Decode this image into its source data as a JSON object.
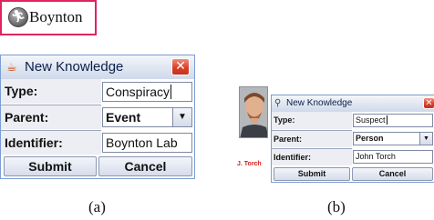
{
  "figure_a": {
    "node": {
      "label": "Boynton",
      "icon": "running-person-icon",
      "border_color": "#e0245e"
    },
    "dialog": {
      "title": "New Knowledge",
      "fields": [
        {
          "label": "Type:",
          "value": "Conspiracy"
        },
        {
          "label": "Parent:",
          "value": "Event"
        },
        {
          "label": "Identifier:",
          "value": "Boynton Lab"
        }
      ],
      "buttons": {
        "submit": "Submit",
        "cancel": "Cancel"
      }
    },
    "caption": "(a)"
  },
  "figure_b": {
    "person_name": "J. Torch",
    "dialog": {
      "title": "New Knowledge",
      "fields": [
        {
          "label": "Type:",
          "value": "Suspect"
        },
        {
          "label": "Parent:",
          "value": "Person"
        },
        {
          "label": "Identifier:",
          "value": "John Torch"
        }
      ],
      "buttons": {
        "submit": "Submit",
        "cancel": "Cancel"
      }
    },
    "caption": "(b)"
  },
  "colors": {
    "close_button": "#d9412b",
    "title_bar": "#dfe6f1",
    "name_label": "#d41a1a"
  }
}
